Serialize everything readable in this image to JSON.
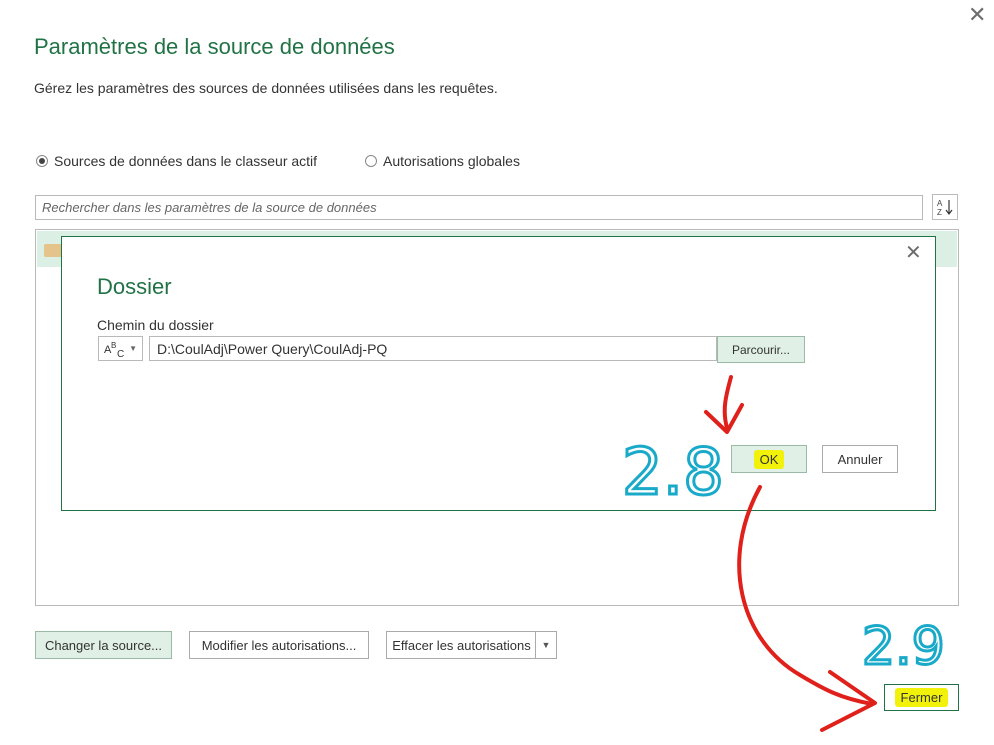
{
  "window": {
    "title": "Paramètres de la source de données",
    "description": "Gérez les paramètres des sources de données utilisées dans les requêtes."
  },
  "scope": {
    "options": [
      {
        "label": "Sources de données dans le classeur actif",
        "selected": true
      },
      {
        "label": "Autorisations globales",
        "selected": false
      }
    ]
  },
  "search": {
    "placeholder": "Rechercher dans les paramètres de la source de données",
    "value": ""
  },
  "sort_button": {
    "icon": "sort-az-icon"
  },
  "dialog": {
    "title": "Dossier",
    "field_label": "Chemin du dossier",
    "type_selector": {
      "icon": "text-type-abc-icon"
    },
    "path_value": "D:\\CoulAdj\\Power Query\\CoulAdj-PQ",
    "browse_label": "Parcourir...",
    "ok_label": "OK",
    "cancel_label": "Annuler"
  },
  "actions": {
    "change_source": "Changer la source...",
    "edit_permissions": "Modifier les autorisations...",
    "clear_permissions": "Effacer les autorisations",
    "close": "Fermer"
  },
  "annotations": {
    "step_ok": "2.8",
    "step_close": "2.9"
  },
  "colors": {
    "accent_green": "#217346",
    "selection_green": "#dcefe4",
    "highlight_yellow": "#f1f10a",
    "annotation_red": "#e0201a",
    "annotation_teal": "#19a9c9"
  }
}
